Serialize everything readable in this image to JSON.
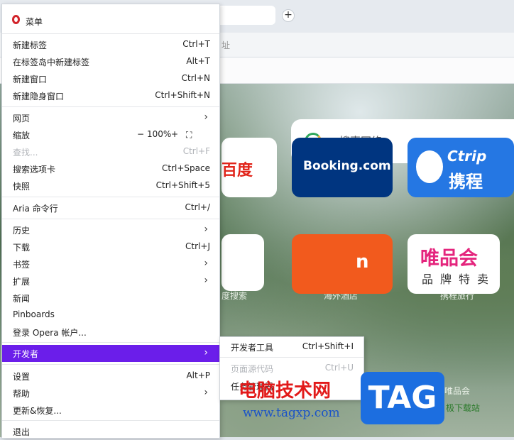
{
  "browser": {
    "address_ghost": "址",
    "new_tab_glyph": "+",
    "search": {
      "placeholder": "搜索网络"
    },
    "tiles": [
      {
        "name": "百度",
        "label": "度搜索"
      },
      {
        "name": "Booking.com",
        "label": "海外酒店"
      },
      {
        "name_line1": "Ctrip",
        "name_line2": "携程",
        "label": "携程旅行"
      },
      {
        "name": "n"
      },
      {
        "name_line1": "唯品会",
        "name_line2": "品牌特卖",
        "label": "唯品会"
      }
    ]
  },
  "menu": {
    "title": "菜单",
    "items": [
      {
        "label": "新建标签",
        "shortcut": "Ctrl+T"
      },
      {
        "label": "在标签岛中新建标签",
        "shortcut": "Alt+T"
      },
      {
        "label": "新建窗口",
        "shortcut": "Ctrl+N"
      },
      {
        "label": "新建隐身窗口",
        "shortcut": "Ctrl+Shift+N"
      },
      {
        "label": "网页",
        "arrow": "›"
      },
      {
        "label": "缩放",
        "zoom_minus": "−",
        "zoom_value": "100%",
        "zoom_plus": "+",
        "fullscreen_glyph": "⛶"
      },
      {
        "label": "查找...",
        "shortcut": "Ctrl+F"
      },
      {
        "label": "搜索选项卡",
        "shortcut": "Ctrl+Space"
      },
      {
        "label": "快照",
        "shortcut": "Ctrl+Shift+5"
      },
      {
        "label": "Aria 命令行",
        "shortcut": "Ctrl+/"
      },
      {
        "label": "历史",
        "arrow": "›"
      },
      {
        "label": "下载",
        "shortcut": "Ctrl+J"
      },
      {
        "label": "书签",
        "arrow": "›"
      },
      {
        "label": "扩展",
        "arrow": "›"
      },
      {
        "label": "新闻"
      },
      {
        "label": "Pinboards"
      },
      {
        "label": "登录 Opera 帐户..."
      },
      {
        "label": "开发者",
        "arrow": "›"
      },
      {
        "label": "设置",
        "shortcut": "Alt+P"
      },
      {
        "label": "帮助",
        "arrow": "›"
      },
      {
        "label": "更新&恢复..."
      },
      {
        "label": "退出"
      }
    ]
  },
  "developer_submenu": {
    "items": [
      {
        "label": "开发者工具",
        "shortcut": "Ctrl+Shift+I"
      },
      {
        "label": "页面源代码",
        "shortcut": "Ctrl+U"
      },
      {
        "label": "任务管理器"
      }
    ]
  },
  "watermark": {
    "title": "电脑技术网",
    "url": "www.tagxp.com",
    "tag": "TAG",
    "sub": "极下载站"
  },
  "colors": {
    "accent_active": "#6b1eea",
    "opera_red": "#d2232a"
  }
}
